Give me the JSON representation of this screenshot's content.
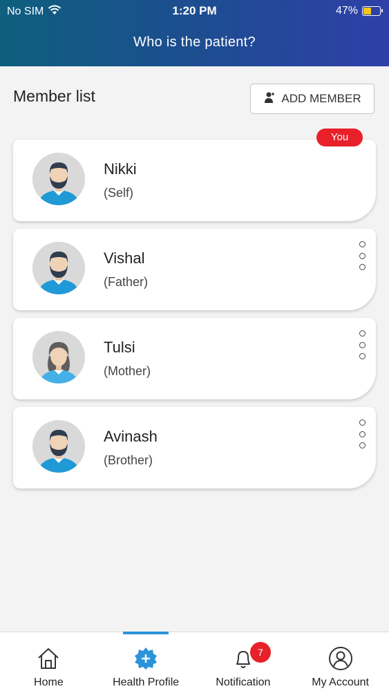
{
  "status_bar": {
    "carrier": "No SIM",
    "time": "1:20 PM",
    "battery": "47%",
    "battery_level": 0.47
  },
  "header": {
    "title": "Who is the patient?"
  },
  "section": {
    "title": "Member list",
    "add_button_label": "ADD MEMBER"
  },
  "members": [
    {
      "name": "Nikki",
      "relation": "(Self)",
      "avatar": "male-avatar-icon",
      "badge": "You"
    },
    {
      "name": "Vishal",
      "relation": "(Father)",
      "avatar": "male-avatar-icon"
    },
    {
      "name": "Tulsi",
      "relation": "(Mother)",
      "avatar": "female-avatar-icon"
    },
    {
      "name": "Avinash",
      "relation": "(Brother)",
      "avatar": "male-avatar-icon"
    }
  ],
  "bottom_nav": [
    {
      "label": "Home",
      "icon": "home-icon"
    },
    {
      "label": "Health Profile",
      "icon": "health-profile-icon",
      "active": true
    },
    {
      "label": "Notification",
      "icon": "bell-icon",
      "badge": "7"
    },
    {
      "label": "My Account",
      "icon": "account-icon"
    }
  ],
  "colors": {
    "accent": "#2b93d9",
    "badge": "#e8202a",
    "header_start": "#0f5f7e",
    "header_end": "#2f3fa8"
  }
}
